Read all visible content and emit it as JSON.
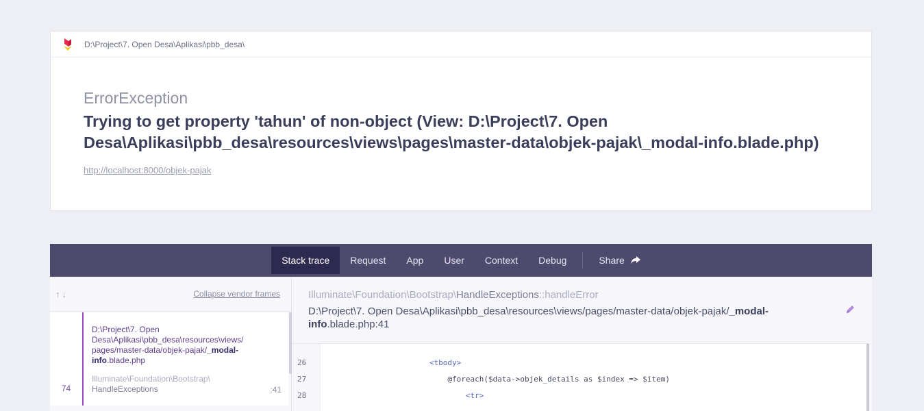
{
  "header": {
    "path": "D:\\Project\\7. Open Desa\\Aplikasi\\pbb_desa\\"
  },
  "error": {
    "class": "ErrorException",
    "message": "Trying to get property 'tahun' of non-object (View: D:\\Project\\7. Open Desa\\Aplikasi\\pbb_desa\\resources\\views\\pages\\master-data\\objek-pajak\\_modal-info.blade.php)",
    "url": "http://localhost:8000/objek-pajak"
  },
  "tabs": [
    {
      "label": "Stack trace",
      "active": true
    },
    {
      "label": "Request"
    },
    {
      "label": "App"
    },
    {
      "label": "User"
    },
    {
      "label": "Context"
    },
    {
      "label": "Debug"
    }
  ],
  "share_label": "Share",
  "frames": {
    "collapse_label": "Collapse vendor frames",
    "item": {
      "number": "74",
      "file_path": "D:\\Project\\7. Open Desa\\Aplikasi\\pbb_desa\\resources\\views/ pages/master-data/objek-pajak/",
      "file_name": "_modal-info",
      "file_ext": ".blade.php",
      "class_ns": "Illuminate\\Foundation\\Bootstrap\\",
      "class_name": "HandleExceptions",
      "line": ":41"
    }
  },
  "detail": {
    "class_ns": "Illuminate\\Foundation\\Bootstrap\\",
    "class_name": "HandleExceptions",
    "method": "::handleError",
    "file_path": "D:\\Project\\7. Open Desa\\Aplikasi\\pbb_desa\\resources\\views/pages/master-data/objek-pajak/",
    "file_name": "_modal-info",
    "file_ext": ".blade.php:41"
  },
  "code": {
    "line_numbers": [
      "26",
      "27",
      "28"
    ],
    "lines": [
      "                        <tbody>",
      "                            @foreach($data->objek_details as $index => $item)",
      "                                <tr>"
    ]
  },
  "colors": {
    "tabs_bar": "#4d4a6d",
    "active_tab": "#2e2a4f",
    "frame_accent": "#9b44c7"
  }
}
